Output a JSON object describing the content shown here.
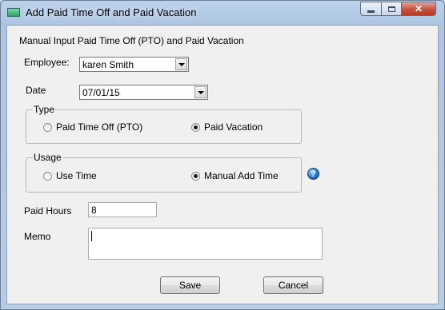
{
  "window": {
    "title": "Add Paid Time Off and Paid Vacation",
    "controls": {
      "minimize": "minimize",
      "maximize": "maximize",
      "close": "✕"
    }
  },
  "header": {
    "text": "Manual Input Paid Time Off (PTO) and Paid Vacation"
  },
  "employee": {
    "label": "Employee:",
    "value": "karen Smith"
  },
  "date": {
    "label": "Date",
    "value": "07/01/15"
  },
  "type": {
    "title": "Type",
    "options": [
      {
        "label": "Paid Time Off (PTO)",
        "checked": false
      },
      {
        "label": "Paid Vacation",
        "checked": true
      }
    ]
  },
  "usage": {
    "title": "Usage",
    "options": [
      {
        "label": "Use Time",
        "checked": false
      },
      {
        "label": "Manual Add Time",
        "checked": true
      }
    ],
    "help_icon": "help-icon"
  },
  "paid_hours": {
    "label": "Paid Hours",
    "value": "8"
  },
  "memo": {
    "label": "Memo",
    "value": ""
  },
  "buttons": {
    "save": "Save",
    "cancel": "Cancel"
  }
}
